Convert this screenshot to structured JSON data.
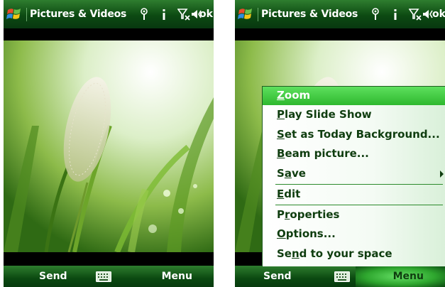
{
  "left": {
    "title": "Pictures & Videos",
    "ok": "ok",
    "soft_left": "Send",
    "soft_right": "Menu"
  },
  "right": {
    "title": "Pictures & Videos",
    "ok": "ok",
    "soft_left": "Send",
    "soft_right": "Menu",
    "menu": {
      "selected": "Zoom",
      "items": [
        {
          "label": "Zoom",
          "accel": "Z"
        },
        {
          "label": "Play Slide Show",
          "accel": "P"
        },
        {
          "label": "Set as Today Background...",
          "accel": "S"
        },
        {
          "label": "Beam picture...",
          "accel": "B"
        },
        {
          "label": "Save",
          "accel": "a",
          "submenu": true
        },
        {
          "label": "Edit",
          "accel": "E"
        },
        {
          "label": "Properties",
          "accel": "r"
        },
        {
          "label": "Options...",
          "accel": "O"
        },
        {
          "label": "Send to your space",
          "accel": "n"
        }
      ]
    }
  },
  "icons": [
    "windows-start-icon",
    "signal-icon",
    "info-icon",
    "no-signal-icon",
    "volume-icon",
    "keyboard-icon",
    "submenu-arrow-icon"
  ],
  "colors": {
    "bar_green": "#0c4a12",
    "menu_highlight": "#3cc83c",
    "menu_text": "#0f3d0f"
  }
}
